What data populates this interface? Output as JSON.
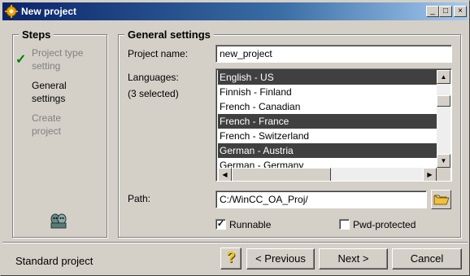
{
  "window": {
    "title": "New project",
    "icon": "gear-app-icon",
    "controls": {
      "minimize": "_",
      "maximize": "□",
      "close": "×"
    }
  },
  "steps": {
    "title": "Steps",
    "items": [
      {
        "label": "Project type setting",
        "line1": "Project type",
        "line2": "setting",
        "state": "done"
      },
      {
        "label": "General settings",
        "line1": "General",
        "line2": "settings",
        "state": "current"
      },
      {
        "label": "Create project",
        "line1": "Create",
        "line2": "project",
        "state": "pending"
      }
    ]
  },
  "general": {
    "title": "General settings",
    "project_name_label": "Project name:",
    "project_name_value": "new_project",
    "languages_label": "Languages:",
    "languages_count": "(3 selected)",
    "languages": [
      {
        "label": "English - US",
        "selected": true
      },
      {
        "label": "Finnish - Finland",
        "selected": false
      },
      {
        "label": "French - Canadian",
        "selected": false
      },
      {
        "label": "French - France",
        "selected": true
      },
      {
        "label": "French - Switzerland",
        "selected": false
      },
      {
        "label": "German - Austria",
        "selected": true
      },
      {
        "label": "German - Germany",
        "selected": false
      }
    ],
    "path_label": "Path:",
    "path_value": "C:/WinCC_OA_Proj/",
    "runnable_label": "Runnable",
    "runnable_checked": true,
    "pwd_label": "Pwd-protected",
    "pwd_checked": false
  },
  "footer": {
    "project_kind": "Standard project",
    "help_label": "?",
    "previous_label": "< Previous",
    "next_label": "Next >",
    "cancel_label": "Cancel"
  },
  "colors": {
    "titlebar_start": "#0a246a",
    "titlebar_end": "#a6caf0",
    "selection": "#404040",
    "check": "#008000",
    "help_icon": "#e8c800"
  }
}
